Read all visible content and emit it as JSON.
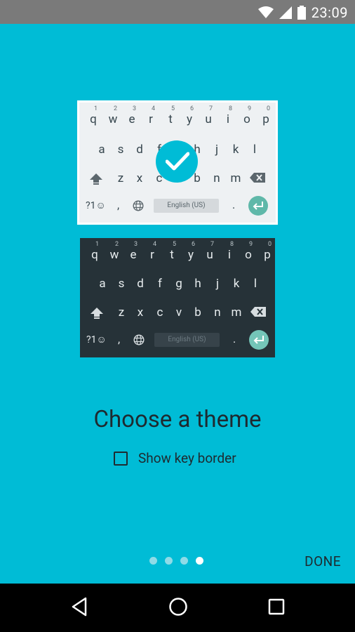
{
  "status_bar": {
    "time": "23:09",
    "icons": [
      "wifi-icon",
      "cell-signal-icon",
      "battery-icon"
    ]
  },
  "keyboard": {
    "row1_letters": [
      "q",
      "w",
      "e",
      "r",
      "t",
      "y",
      "u",
      "i",
      "o",
      "p"
    ],
    "row1_numbers": [
      "1",
      "2",
      "3",
      "4",
      "5",
      "6",
      "7",
      "8",
      "9",
      "0"
    ],
    "row2": [
      "a",
      "s",
      "d",
      "f",
      "g",
      "h",
      "j",
      "k",
      "l"
    ],
    "row3": [
      "z",
      "x",
      "c",
      "v",
      "b",
      "n",
      "m"
    ],
    "symbols_key": "?1☺",
    "comma_key": ",",
    "period_key": ".",
    "space_label": "English (US)"
  },
  "title": "Choose a theme",
  "option_label": "Show key border",
  "option_checked": false,
  "pagination": {
    "total": 4,
    "active_index": 3
  },
  "done_label": "DONE",
  "colors": {
    "background": "#00bcd6",
    "enter_key": "#5fb8a9",
    "dark_keyboard": "#263238"
  }
}
